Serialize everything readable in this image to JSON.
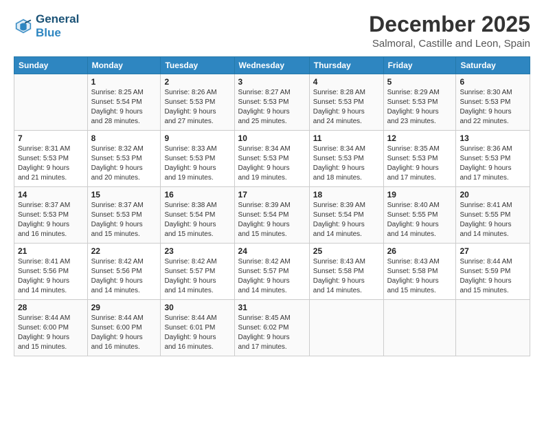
{
  "header": {
    "logo_line1": "General",
    "logo_line2": "Blue",
    "month_title": "December 2025",
    "location": "Salmoral, Castille and Leon, Spain"
  },
  "days_of_week": [
    "Sunday",
    "Monday",
    "Tuesday",
    "Wednesday",
    "Thursday",
    "Friday",
    "Saturday"
  ],
  "weeks": [
    [
      {
        "day": "",
        "info": ""
      },
      {
        "day": "1",
        "info": "Sunrise: 8:25 AM\nSunset: 5:54 PM\nDaylight: 9 hours\nand 28 minutes."
      },
      {
        "day": "2",
        "info": "Sunrise: 8:26 AM\nSunset: 5:53 PM\nDaylight: 9 hours\nand 27 minutes."
      },
      {
        "day": "3",
        "info": "Sunrise: 8:27 AM\nSunset: 5:53 PM\nDaylight: 9 hours\nand 25 minutes."
      },
      {
        "day": "4",
        "info": "Sunrise: 8:28 AM\nSunset: 5:53 PM\nDaylight: 9 hours\nand 24 minutes."
      },
      {
        "day": "5",
        "info": "Sunrise: 8:29 AM\nSunset: 5:53 PM\nDaylight: 9 hours\nand 23 minutes."
      },
      {
        "day": "6",
        "info": "Sunrise: 8:30 AM\nSunset: 5:53 PM\nDaylight: 9 hours\nand 22 minutes."
      }
    ],
    [
      {
        "day": "7",
        "info": "Sunrise: 8:31 AM\nSunset: 5:53 PM\nDaylight: 9 hours\nand 21 minutes."
      },
      {
        "day": "8",
        "info": "Sunrise: 8:32 AM\nSunset: 5:53 PM\nDaylight: 9 hours\nand 20 minutes."
      },
      {
        "day": "9",
        "info": "Sunrise: 8:33 AM\nSunset: 5:53 PM\nDaylight: 9 hours\nand 19 minutes."
      },
      {
        "day": "10",
        "info": "Sunrise: 8:34 AM\nSunset: 5:53 PM\nDaylight: 9 hours\nand 19 minutes."
      },
      {
        "day": "11",
        "info": "Sunrise: 8:34 AM\nSunset: 5:53 PM\nDaylight: 9 hours\nand 18 minutes."
      },
      {
        "day": "12",
        "info": "Sunrise: 8:35 AM\nSunset: 5:53 PM\nDaylight: 9 hours\nand 17 minutes."
      },
      {
        "day": "13",
        "info": "Sunrise: 8:36 AM\nSunset: 5:53 PM\nDaylight: 9 hours\nand 17 minutes."
      }
    ],
    [
      {
        "day": "14",
        "info": "Sunrise: 8:37 AM\nSunset: 5:53 PM\nDaylight: 9 hours\nand 16 minutes."
      },
      {
        "day": "15",
        "info": "Sunrise: 8:37 AM\nSunset: 5:53 PM\nDaylight: 9 hours\nand 15 minutes."
      },
      {
        "day": "16",
        "info": "Sunrise: 8:38 AM\nSunset: 5:54 PM\nDaylight: 9 hours\nand 15 minutes."
      },
      {
        "day": "17",
        "info": "Sunrise: 8:39 AM\nSunset: 5:54 PM\nDaylight: 9 hours\nand 15 minutes."
      },
      {
        "day": "18",
        "info": "Sunrise: 8:39 AM\nSunset: 5:54 PM\nDaylight: 9 hours\nand 14 minutes."
      },
      {
        "day": "19",
        "info": "Sunrise: 8:40 AM\nSunset: 5:55 PM\nDaylight: 9 hours\nand 14 minutes."
      },
      {
        "day": "20",
        "info": "Sunrise: 8:41 AM\nSunset: 5:55 PM\nDaylight: 9 hours\nand 14 minutes."
      }
    ],
    [
      {
        "day": "21",
        "info": "Sunrise: 8:41 AM\nSunset: 5:56 PM\nDaylight: 9 hours\nand 14 minutes."
      },
      {
        "day": "22",
        "info": "Sunrise: 8:42 AM\nSunset: 5:56 PM\nDaylight: 9 hours\nand 14 minutes."
      },
      {
        "day": "23",
        "info": "Sunrise: 8:42 AM\nSunset: 5:57 PM\nDaylight: 9 hours\nand 14 minutes."
      },
      {
        "day": "24",
        "info": "Sunrise: 8:42 AM\nSunset: 5:57 PM\nDaylight: 9 hours\nand 14 minutes."
      },
      {
        "day": "25",
        "info": "Sunrise: 8:43 AM\nSunset: 5:58 PM\nDaylight: 9 hours\nand 14 minutes."
      },
      {
        "day": "26",
        "info": "Sunrise: 8:43 AM\nSunset: 5:58 PM\nDaylight: 9 hours\nand 15 minutes."
      },
      {
        "day": "27",
        "info": "Sunrise: 8:44 AM\nSunset: 5:59 PM\nDaylight: 9 hours\nand 15 minutes."
      }
    ],
    [
      {
        "day": "28",
        "info": "Sunrise: 8:44 AM\nSunset: 6:00 PM\nDaylight: 9 hours\nand 15 minutes."
      },
      {
        "day": "29",
        "info": "Sunrise: 8:44 AM\nSunset: 6:00 PM\nDaylight: 9 hours\nand 16 minutes."
      },
      {
        "day": "30",
        "info": "Sunrise: 8:44 AM\nSunset: 6:01 PM\nDaylight: 9 hours\nand 16 minutes."
      },
      {
        "day": "31",
        "info": "Sunrise: 8:45 AM\nSunset: 6:02 PM\nDaylight: 9 hours\nand 17 minutes."
      },
      {
        "day": "",
        "info": ""
      },
      {
        "day": "",
        "info": ""
      },
      {
        "day": "",
        "info": ""
      }
    ]
  ]
}
